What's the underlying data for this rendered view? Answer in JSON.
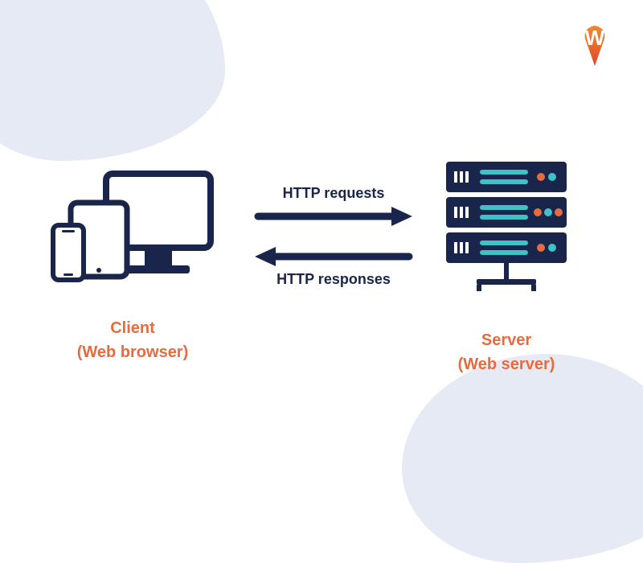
{
  "logo": {
    "letter": "W",
    "name": "brand-logo"
  },
  "client": {
    "title": "Client",
    "subtitle": "(Web browser)"
  },
  "server": {
    "title": "Server",
    "subtitle": "(Web server)"
  },
  "arrows": {
    "request_label": "HTTP requests",
    "response_label": "HTTP responses"
  },
  "colors": {
    "navy": "#19254a",
    "orange": "#e86b3f",
    "cyan": "#3ec1c7",
    "blob": "#e6eaf5"
  }
}
